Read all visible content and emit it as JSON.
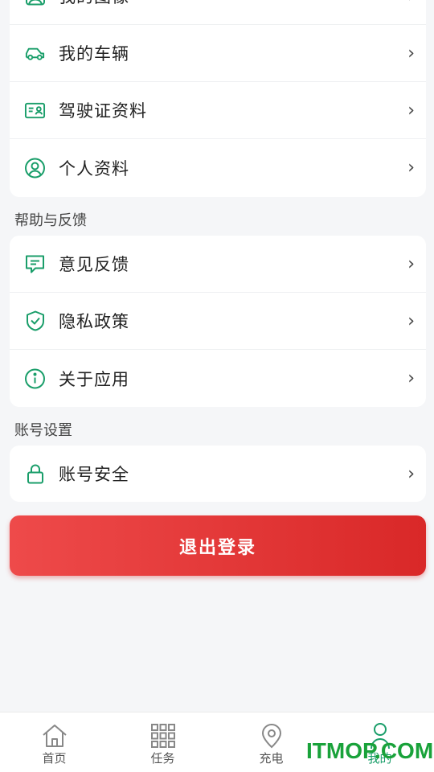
{
  "profile_card": {
    "items": [
      {
        "label": "我的图像",
        "icon": "portrait-icon"
      },
      {
        "label": "我的车辆",
        "icon": "car-icon"
      },
      {
        "label": "驾驶证资料",
        "icon": "id-card-icon"
      },
      {
        "label": "个人资料",
        "icon": "user-circle-icon"
      }
    ]
  },
  "help_section": {
    "title": "帮助与反馈",
    "items": [
      {
        "label": "意见反馈",
        "icon": "feedback-icon"
      },
      {
        "label": "隐私政策",
        "icon": "shield-check-icon"
      },
      {
        "label": "关于应用",
        "icon": "info-icon"
      }
    ]
  },
  "account_section": {
    "title": "账号设置",
    "items": [
      {
        "label": "账号安全",
        "icon": "lock-icon"
      }
    ]
  },
  "chevron": "›",
  "logout_label": "退出登录",
  "tabbar": {
    "tabs": [
      {
        "label": "首页",
        "icon": "home-icon"
      },
      {
        "label": "任务",
        "icon": "grid-icon"
      },
      {
        "label": "充电",
        "icon": "location-pin-icon"
      },
      {
        "label": "我的",
        "icon": "user-icon",
        "active": true
      }
    ]
  },
  "watermark": "ITMOP.COM",
  "colors": {
    "accent": "#1a9e6a",
    "danger": "#e23636",
    "watermark": "#19a23a"
  }
}
